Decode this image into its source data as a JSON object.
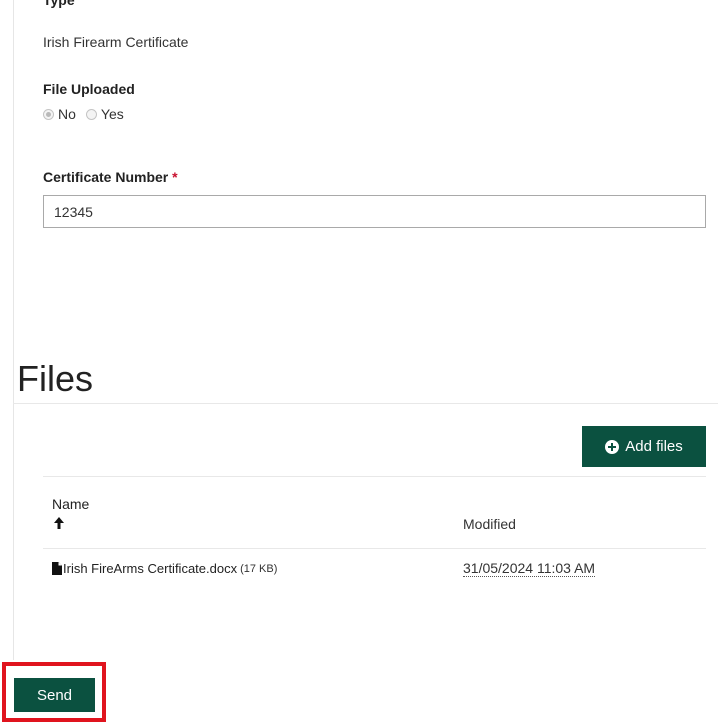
{
  "form": {
    "type_label": "Type",
    "type_value": "Irish Firearm Certificate",
    "file_uploaded_label": "File Uploaded",
    "radio_options": [
      "No",
      "Yes"
    ],
    "radio_selected": "No",
    "certificate_label": "Certificate Number",
    "required_marker": "*",
    "certificate_value": "12345"
  },
  "files": {
    "heading": "Files",
    "add_button_label": "Add files",
    "columns": {
      "name": "Name",
      "modified": "Modified"
    },
    "rows": [
      {
        "name": "Irish FireArms Certificate.docx",
        "size": "(17 KB)",
        "modified": "31/05/2024 11:03 AM"
      }
    ]
  },
  "actions": {
    "send_label": "Send"
  },
  "colors": {
    "primary": "#0b5140",
    "required": "#c8102e",
    "highlight": "#e0141e"
  }
}
